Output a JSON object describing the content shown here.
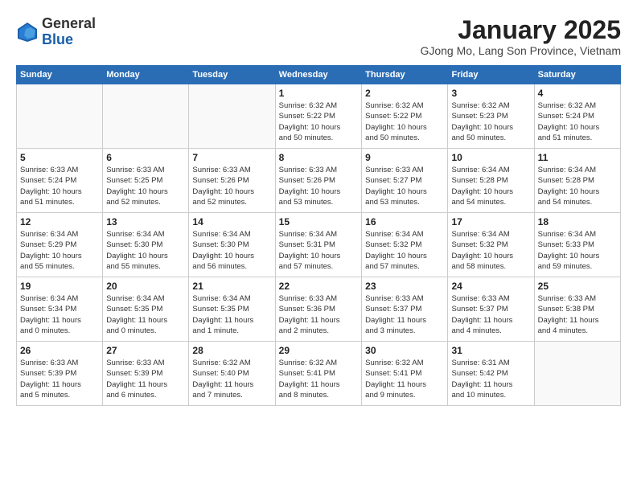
{
  "header": {
    "logo_general": "General",
    "logo_blue": "Blue",
    "month_title": "January 2025",
    "location": "GJong Mo, Lang Son Province, Vietnam"
  },
  "weekdays": [
    "Sunday",
    "Monday",
    "Tuesday",
    "Wednesday",
    "Thursday",
    "Friday",
    "Saturday"
  ],
  "weeks": [
    [
      {
        "day": "",
        "info": ""
      },
      {
        "day": "",
        "info": ""
      },
      {
        "day": "",
        "info": ""
      },
      {
        "day": "1",
        "info": "Sunrise: 6:32 AM\nSunset: 5:22 PM\nDaylight: 10 hours\nand 50 minutes."
      },
      {
        "day": "2",
        "info": "Sunrise: 6:32 AM\nSunset: 5:22 PM\nDaylight: 10 hours\nand 50 minutes."
      },
      {
        "day": "3",
        "info": "Sunrise: 6:32 AM\nSunset: 5:23 PM\nDaylight: 10 hours\nand 50 minutes."
      },
      {
        "day": "4",
        "info": "Sunrise: 6:32 AM\nSunset: 5:24 PM\nDaylight: 10 hours\nand 51 minutes."
      }
    ],
    [
      {
        "day": "5",
        "info": "Sunrise: 6:33 AM\nSunset: 5:24 PM\nDaylight: 10 hours\nand 51 minutes."
      },
      {
        "day": "6",
        "info": "Sunrise: 6:33 AM\nSunset: 5:25 PM\nDaylight: 10 hours\nand 52 minutes."
      },
      {
        "day": "7",
        "info": "Sunrise: 6:33 AM\nSunset: 5:26 PM\nDaylight: 10 hours\nand 52 minutes."
      },
      {
        "day": "8",
        "info": "Sunrise: 6:33 AM\nSunset: 5:26 PM\nDaylight: 10 hours\nand 53 minutes."
      },
      {
        "day": "9",
        "info": "Sunrise: 6:33 AM\nSunset: 5:27 PM\nDaylight: 10 hours\nand 53 minutes."
      },
      {
        "day": "10",
        "info": "Sunrise: 6:34 AM\nSunset: 5:28 PM\nDaylight: 10 hours\nand 54 minutes."
      },
      {
        "day": "11",
        "info": "Sunrise: 6:34 AM\nSunset: 5:28 PM\nDaylight: 10 hours\nand 54 minutes."
      }
    ],
    [
      {
        "day": "12",
        "info": "Sunrise: 6:34 AM\nSunset: 5:29 PM\nDaylight: 10 hours\nand 55 minutes."
      },
      {
        "day": "13",
        "info": "Sunrise: 6:34 AM\nSunset: 5:30 PM\nDaylight: 10 hours\nand 55 minutes."
      },
      {
        "day": "14",
        "info": "Sunrise: 6:34 AM\nSunset: 5:30 PM\nDaylight: 10 hours\nand 56 minutes."
      },
      {
        "day": "15",
        "info": "Sunrise: 6:34 AM\nSunset: 5:31 PM\nDaylight: 10 hours\nand 57 minutes."
      },
      {
        "day": "16",
        "info": "Sunrise: 6:34 AM\nSunset: 5:32 PM\nDaylight: 10 hours\nand 57 minutes."
      },
      {
        "day": "17",
        "info": "Sunrise: 6:34 AM\nSunset: 5:32 PM\nDaylight: 10 hours\nand 58 minutes."
      },
      {
        "day": "18",
        "info": "Sunrise: 6:34 AM\nSunset: 5:33 PM\nDaylight: 10 hours\nand 59 minutes."
      }
    ],
    [
      {
        "day": "19",
        "info": "Sunrise: 6:34 AM\nSunset: 5:34 PM\nDaylight: 11 hours\nand 0 minutes."
      },
      {
        "day": "20",
        "info": "Sunrise: 6:34 AM\nSunset: 5:35 PM\nDaylight: 11 hours\nand 0 minutes."
      },
      {
        "day": "21",
        "info": "Sunrise: 6:34 AM\nSunset: 5:35 PM\nDaylight: 11 hours\nand 1 minute."
      },
      {
        "day": "22",
        "info": "Sunrise: 6:33 AM\nSunset: 5:36 PM\nDaylight: 11 hours\nand 2 minutes."
      },
      {
        "day": "23",
        "info": "Sunrise: 6:33 AM\nSunset: 5:37 PM\nDaylight: 11 hours\nand 3 minutes."
      },
      {
        "day": "24",
        "info": "Sunrise: 6:33 AM\nSunset: 5:37 PM\nDaylight: 11 hours\nand 4 minutes."
      },
      {
        "day": "25",
        "info": "Sunrise: 6:33 AM\nSunset: 5:38 PM\nDaylight: 11 hours\nand 4 minutes."
      }
    ],
    [
      {
        "day": "26",
        "info": "Sunrise: 6:33 AM\nSunset: 5:39 PM\nDaylight: 11 hours\nand 5 minutes."
      },
      {
        "day": "27",
        "info": "Sunrise: 6:33 AM\nSunset: 5:39 PM\nDaylight: 11 hours\nand 6 minutes."
      },
      {
        "day": "28",
        "info": "Sunrise: 6:32 AM\nSunset: 5:40 PM\nDaylight: 11 hours\nand 7 minutes."
      },
      {
        "day": "29",
        "info": "Sunrise: 6:32 AM\nSunset: 5:41 PM\nDaylight: 11 hours\nand 8 minutes."
      },
      {
        "day": "30",
        "info": "Sunrise: 6:32 AM\nSunset: 5:41 PM\nDaylight: 11 hours\nand 9 minutes."
      },
      {
        "day": "31",
        "info": "Sunrise: 6:31 AM\nSunset: 5:42 PM\nDaylight: 11 hours\nand 10 minutes."
      },
      {
        "day": "",
        "info": ""
      }
    ]
  ]
}
